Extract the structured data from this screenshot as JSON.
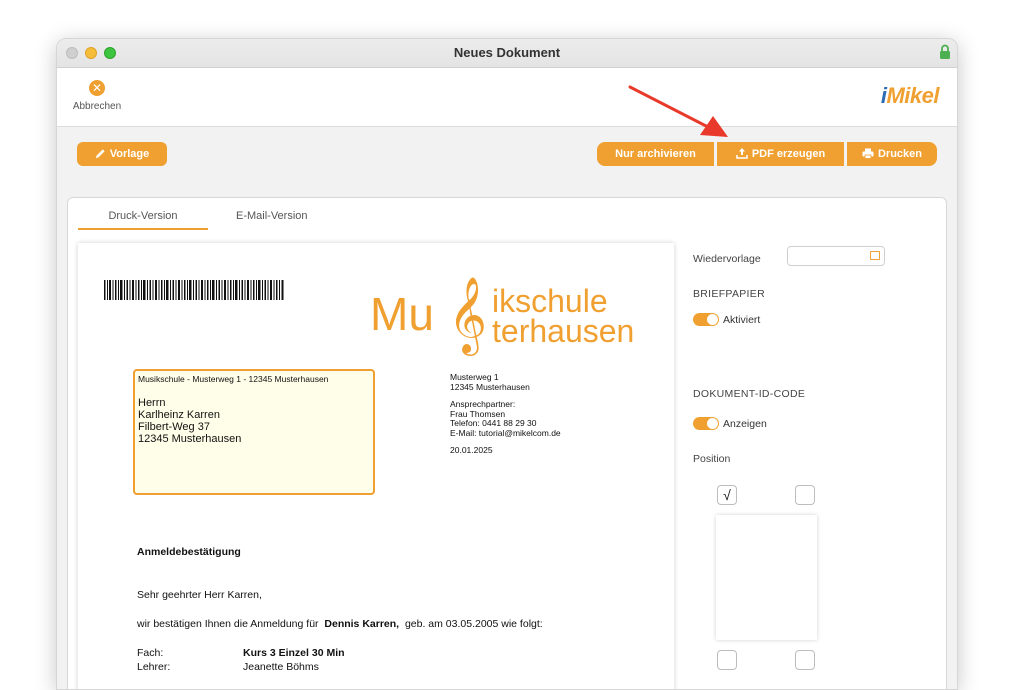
{
  "window": {
    "title": "Neues Dokument"
  },
  "toolbar": {
    "cancel_label": "Abbrechen",
    "logo_i": "i",
    "logo_text": "Mikel"
  },
  "actions": {
    "vorlage": "Vorlage",
    "nur_archivieren": "Nur archivieren",
    "pdf_erzeugen": "PDF erzeugen",
    "drucken": "Drucken"
  },
  "tabs": [
    {
      "label": "Druck-Version",
      "active": true
    },
    {
      "label": "E-Mail-Version",
      "active": false
    }
  ],
  "document": {
    "brand_big": "Mu",
    "brand_clef": "𝄞",
    "brand_line1": "ikschule",
    "brand_line2": "terhausen",
    "sender_line": "Musikschule - Musterweg 1 - 12345 Musterhausen",
    "recipient": [
      "Herrn",
      "Karlheinz Karren",
      "Filbert-Weg 37",
      "12345 Musterhausen"
    ],
    "info": {
      "street": "Musterweg 1",
      "city": "12345 Musterhausen",
      "contact_label": "Ansprechpartner:",
      "contact_name": "Frau Thomsen",
      "phone": "Telefon: 0441 88 29 30",
      "email": "E-Mail: tutorial@mikelcom.de",
      "date": "20.01.2025"
    },
    "heading": "Anmeldebestätigung",
    "greeting": "Sehr geehrter Herr Karren,",
    "intro_pre": "wir bestätigen Ihnen die Anmeldung für",
    "intro_name": "Dennis Karren,",
    "intro_post": "geb. am 03.05.2005 wie folgt:",
    "rows": [
      {
        "label": "Fach:",
        "value": "Kurs 3 Einzel 30 Min"
      },
      {
        "label": "Lehrer:",
        "value": "Jeanette Böhms"
      }
    ]
  },
  "sidebar": {
    "wiedervorlage_label": "Wiedervorlage",
    "briefpapier_caption": "BRIEFPAPIER",
    "briefpapier_toggle": "Aktiviert",
    "docid_caption": "DOKUMENT-ID-CODE",
    "docid_toggle": "Anzeigen",
    "position_label": "Position",
    "check_mark": "√"
  },
  "colors": {
    "accent": "#f0a030",
    "arrow": "#e8392a",
    "logo_blue": "#2e6db3"
  }
}
